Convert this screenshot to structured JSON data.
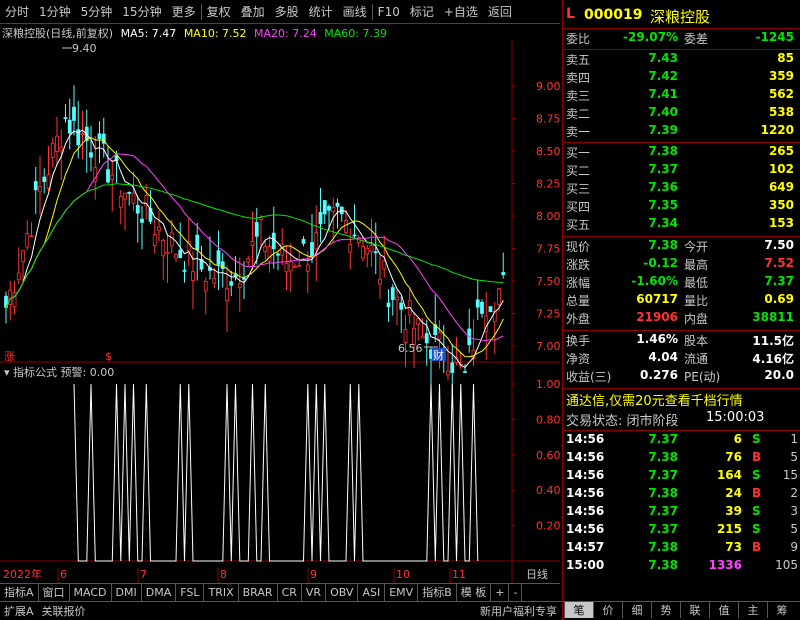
{
  "toolbar": {
    "items": [
      "分时",
      "1分钟",
      "5分钟",
      "15分钟",
      "更多",
      "复权",
      "叠加",
      "多股",
      "统计",
      "画线",
      "F10",
      "标记",
      "+自选",
      "返回"
    ]
  },
  "chart_title": {
    "name": "深粮控股(日线,前复权)",
    "ma5": "MA5: 7.47",
    "ma10": "MA10: 7.52",
    "ma20": "MA20: 7.24",
    "ma60": "MA60: 7.39"
  },
  "price_axis": [
    "9.00",
    "8.75",
    "8.50",
    "8.25",
    "8.00",
    "7.75",
    "7.50",
    "7.25",
    "7.00"
  ],
  "annotations": {
    "high": "9.40",
    "low": "6.56",
    "cai": "财",
    "zhang": "涨"
  },
  "indicator": {
    "title": "指标公式",
    "warn": "预警: 0.00",
    "axis": [
      "1.00",
      "0.80",
      "0.60",
      "0.40",
      "0.20"
    ]
  },
  "time_axis": {
    "year": "2022年",
    "months": [
      "6",
      "7",
      "8",
      "9",
      "10",
      "11"
    ],
    "period": "日线"
  },
  "quote": {
    "code": "000019",
    "name": "深粮控股",
    "weibi_label": "委比",
    "weibi": "-29.07%",
    "weicha_label": "委差",
    "weicha": "-1245",
    "asks": [
      {
        "label": "卖五",
        "price": "7.43",
        "vol": "85"
      },
      {
        "label": "卖四",
        "price": "7.42",
        "vol": "359"
      },
      {
        "label": "卖三",
        "price": "7.41",
        "vol": "562"
      },
      {
        "label": "卖二",
        "price": "7.40",
        "vol": "538"
      },
      {
        "label": "卖一",
        "price": "7.39",
        "vol": "1220"
      }
    ],
    "bids": [
      {
        "label": "买一",
        "price": "7.38",
        "vol": "265"
      },
      {
        "label": "买二",
        "price": "7.37",
        "vol": "102"
      },
      {
        "label": "买三",
        "price": "7.36",
        "vol": "649"
      },
      {
        "label": "买四",
        "price": "7.35",
        "vol": "350"
      },
      {
        "label": "买五",
        "price": "7.34",
        "vol": "153"
      }
    ],
    "stats": [
      {
        "l1": "现价",
        "v1": "7.38",
        "l2": "今开",
        "v2": "7.50"
      },
      {
        "l1": "涨跌",
        "v1": "-0.12",
        "l2": "最高",
        "v2": "7.52"
      },
      {
        "l1": "涨幅",
        "v1": "-1.60%",
        "l2": "最低",
        "v2": "7.37"
      },
      {
        "l1": "总量",
        "v1": "60717",
        "l2": "量比",
        "v2": "0.69"
      },
      {
        "l1": "外盘",
        "v1": "21906",
        "l2": "内盘",
        "v2": "38811"
      }
    ],
    "stats2": [
      {
        "l1": "换手",
        "v1": "1.46%",
        "l2": "股本",
        "v2": "11.5亿"
      },
      {
        "l1": "净资",
        "v1": "4.04",
        "l2": "流通",
        "v2": "4.16亿"
      },
      {
        "l1": "收益(三)",
        "v1": "0.276",
        "l2": "PE(动)",
        "v2": "20.0"
      }
    ],
    "promo": "通达信,仅需20元查看千档行情",
    "trade_status_label": "交易状态: 闭市阶段",
    "trade_status_time": "15:00:03",
    "ticks": [
      {
        "t": "14:56",
        "p": "7.37",
        "v": "6",
        "bs": "S",
        "n": "1"
      },
      {
        "t": "14:56",
        "p": "7.38",
        "v": "76",
        "bs": "B",
        "n": "5"
      },
      {
        "t": "14:56",
        "p": "7.37",
        "v": "164",
        "bs": "S",
        "n": "15"
      },
      {
        "t": "14:56",
        "p": "7.38",
        "v": "24",
        "bs": "B",
        "n": "2"
      },
      {
        "t": "14:56",
        "p": "7.37",
        "v": "39",
        "bs": "S",
        "n": "3"
      },
      {
        "t": "14:56",
        "p": "7.37",
        "v": "215",
        "bs": "S",
        "n": "5"
      },
      {
        "t": "14:57",
        "p": "7.38",
        "v": "73",
        "bs": "B",
        "n": "9"
      },
      {
        "t": "15:00",
        "p": "7.38",
        "v": "1336",
        "bs": "",
        "n": "105"
      }
    ]
  },
  "tabs": [
    "指标A",
    "窗口",
    "MACD",
    "DMI",
    "DMA",
    "FSL",
    "TRIX",
    "BRAR",
    "CR",
    "VR",
    "OBV",
    "ASI",
    "EMV",
    "指标B",
    "模 板",
    "+",
    "-"
  ],
  "bottombar": {
    "left": [
      "扩展A",
      "关联报价"
    ],
    "promo": "新用户福利专享",
    "right_tabs": [
      "笔",
      "价",
      "细",
      "势",
      "联",
      "值",
      "主",
      "筹"
    ]
  },
  "colors": {
    "up": "#ff3232",
    "down": "#54fcfc",
    "ma5": "#ffffff",
    "ma10": "#ffff00",
    "ma20": "#ff40ff",
    "ma60": "#00e600"
  }
}
